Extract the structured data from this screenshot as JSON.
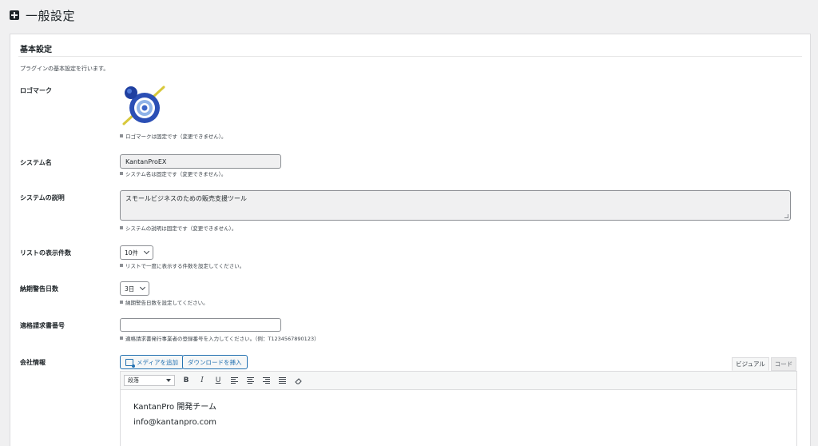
{
  "header": {
    "title": "一般設定",
    "icon": "settings-box-icon"
  },
  "section": {
    "title": "基本設定",
    "description": "プラグインの基本設定を行います。"
  },
  "logo": {
    "label": "ロゴマーク",
    "note": "ロゴマークは固定です（変更できません）。",
    "colors": {
      "blue_dark": "#1f3fa0",
      "blue_light": "#8fb3e8",
      "yellow": "#d8c83a"
    }
  },
  "system_name": {
    "label": "システム名",
    "value": "KantanProEX",
    "note": "システム名は固定です（変更できません）。"
  },
  "system_description": {
    "label": "システムの説明",
    "value": "スモールビジネスのための販売支援ツール",
    "note": "システムの説明は固定です（変更できません）。"
  },
  "list_count": {
    "label": "リストの表示件数",
    "selected": "10件",
    "note": "リストで一度に表示する件数を設定してください。"
  },
  "deadline_warning": {
    "label": "納期警告日数",
    "selected": "3日",
    "note": "納期警告日数を設定してください。"
  },
  "invoice_number": {
    "label": "適格請求書番号",
    "value": "",
    "note": "適格請求書発行事業者の登録番号を入力してください。（例：T1234567890123）"
  },
  "company_info": {
    "label": "会社情報",
    "add_media": "メディアを追加",
    "insert_download": "ダウンロードを挿入",
    "tab_visual": "ビジュアル",
    "tab_code": "コード",
    "format": "段落",
    "content_lines": [
      "KantanPro 開発チーム",
      "info@kantanpro.com"
    ]
  }
}
